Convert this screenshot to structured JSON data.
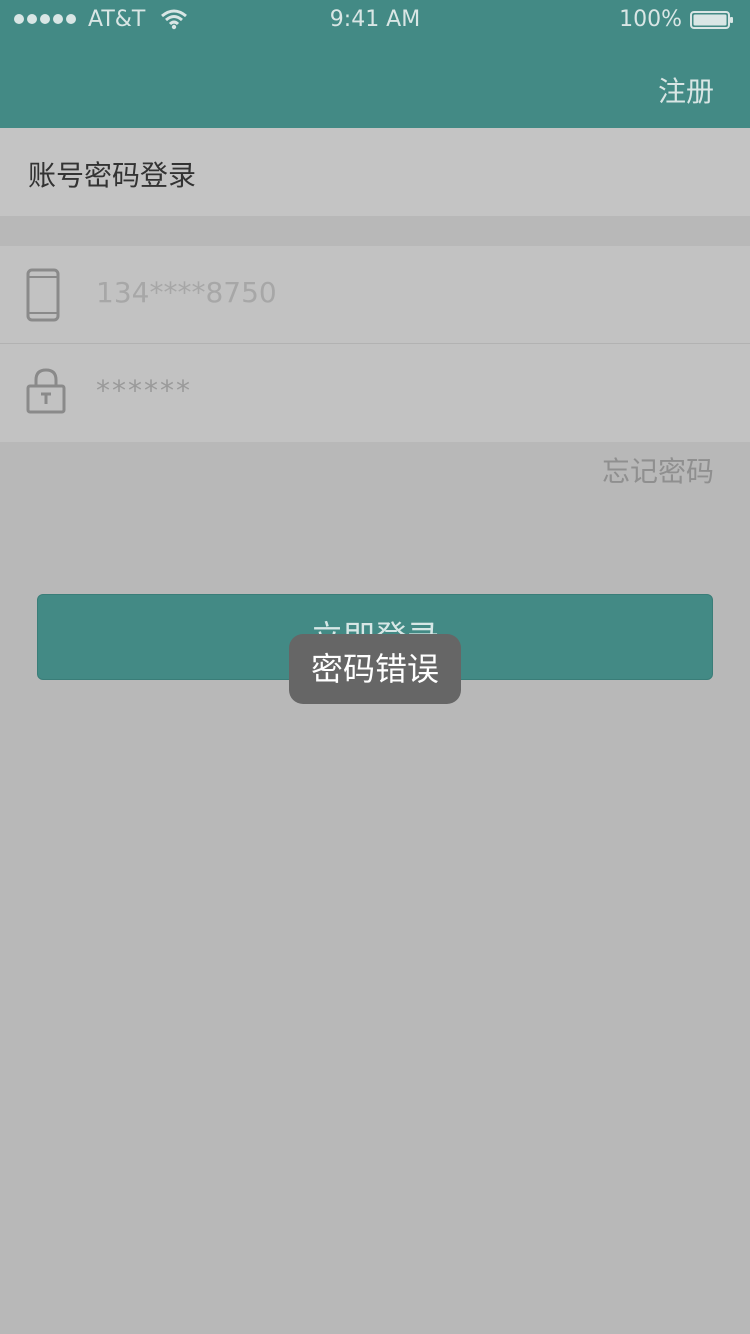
{
  "status_bar": {
    "carrier": "AT&T",
    "time": "9:41 AM",
    "battery": "100%"
  },
  "nav": {
    "register_label": "注册"
  },
  "page": {
    "title": "账号密码登录"
  },
  "form": {
    "phone_value": "134****8750",
    "password_value": "******",
    "forgot_label": "忘记密码",
    "login_label": "立即登录"
  },
  "toast": {
    "message": "密码错误"
  },
  "colors": {
    "brand": "#438a85",
    "toast_bg": "#666666",
    "background": "#b8b8b8"
  },
  "icons": {
    "phone": "phone-icon",
    "lock": "lock-icon",
    "wifi": "wifi-icon",
    "battery": "battery-icon"
  }
}
